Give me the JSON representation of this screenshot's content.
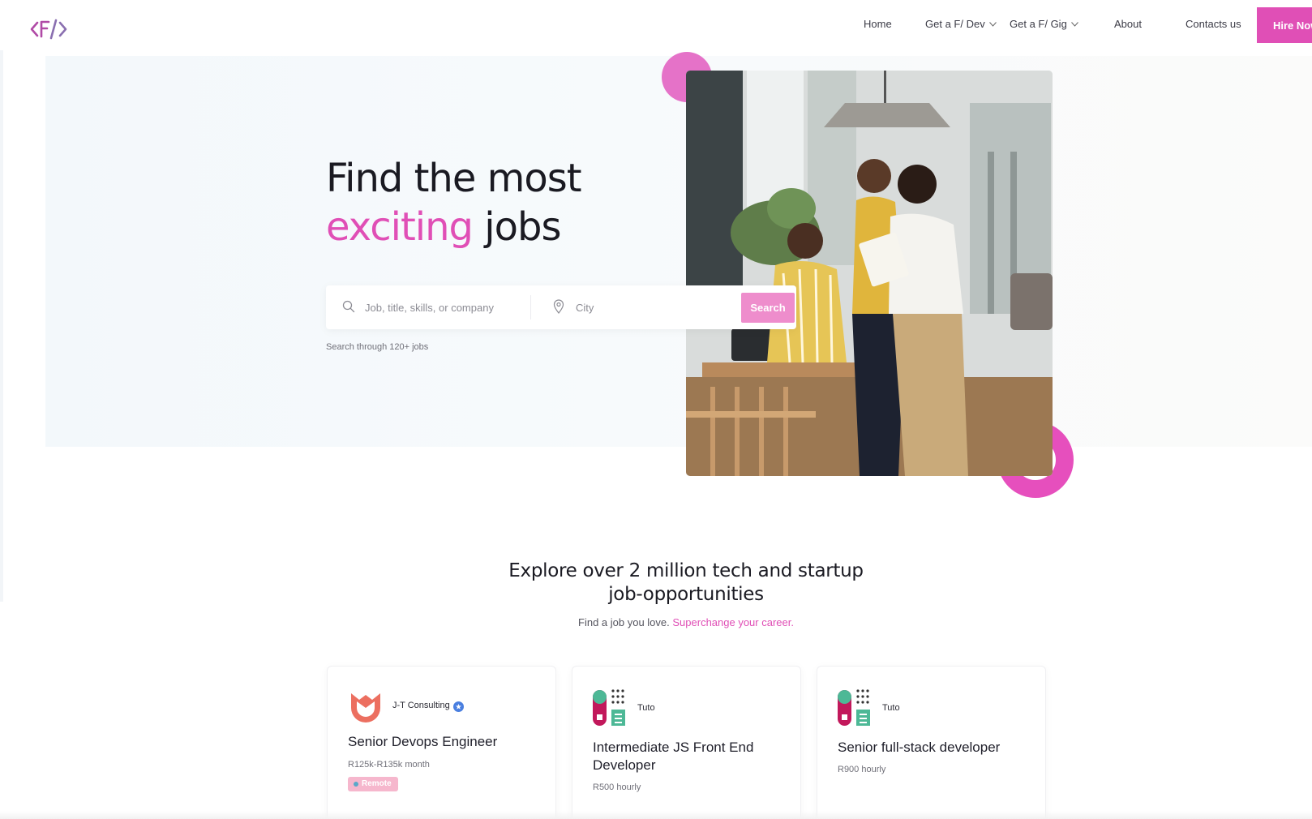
{
  "nav": {
    "logo_alt": "<F/>",
    "items": [
      {
        "label": "Home"
      },
      {
        "label": "Get a F/ Dev"
      },
      {
        "label": "Get a F/ Gig"
      },
      {
        "label": "About"
      },
      {
        "label": "Contacts us"
      }
    ],
    "hire_label": "Hire Now"
  },
  "hero": {
    "title_line1": "Find the most",
    "title_accent": "exciting",
    "title_rest": "jobs",
    "search_placeholder": "Job, title, skills, or company",
    "city_placeholder": "City",
    "search_button": "Search",
    "hint": "Search through 120+ jobs"
  },
  "explore": {
    "title_line1": "Explore over 2 million tech and startup",
    "title_line2": "job-opportunities",
    "subtitle": "Find a job you love.",
    "subtitle_link": "Superchange your career."
  },
  "jobs": [
    {
      "company": "J-T Consulting",
      "verified": true,
      "title": "Senior Devops Engineer",
      "pay": "R125k-R135k month",
      "tag": "Remote"
    },
    {
      "company": "Tuto",
      "verified": false,
      "title": "Intermediate JS Front End Developer",
      "pay": "R500 hourly",
      "tag": ""
    },
    {
      "company": "Tuto",
      "verified": false,
      "title": "Senior full-stack developer",
      "pay": "R900 hourly",
      "tag": ""
    }
  ],
  "colors": {
    "brand": "#e04fb6",
    "search_button": "#ee8dcc",
    "remote_badge": "#f6b7cd"
  }
}
